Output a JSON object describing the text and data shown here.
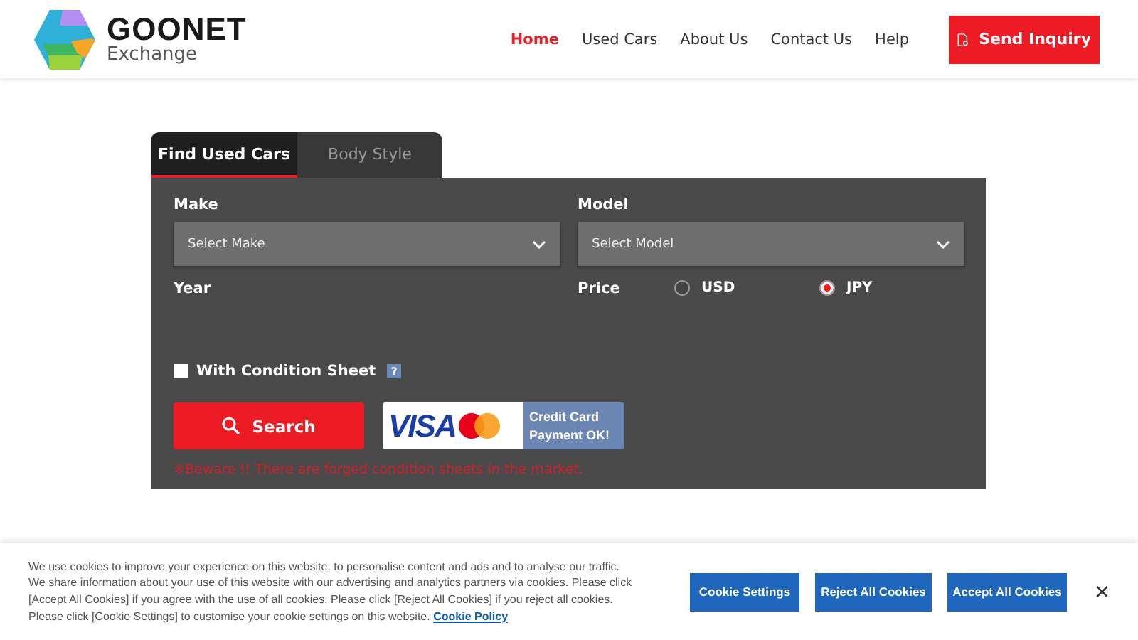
{
  "header": {
    "logo": {
      "name": "GOONET",
      "sub": "Exchange"
    },
    "nav": [
      {
        "label": "Home",
        "selected": true
      },
      {
        "label": "Used Cars",
        "selected": false
      },
      {
        "label": "About Us",
        "selected": false
      },
      {
        "label": "Contact Us",
        "selected": false
      },
      {
        "label": "Help",
        "selected": false
      }
    ],
    "cta": "Send Inquiry"
  },
  "search": {
    "tabs": [
      {
        "label": "Find Used Cars",
        "selected": true
      },
      {
        "label": "Body Style",
        "selected": false
      }
    ],
    "make": {
      "label": "Make",
      "placeholder": "Select Make"
    },
    "model": {
      "label": "Model",
      "placeholder": "Select Model"
    },
    "year": {
      "label": "Year"
    },
    "price": {
      "label": "Price",
      "options": [
        {
          "label": "USD",
          "selected": false
        },
        {
          "label": "JPY",
          "selected": true
        }
      ]
    },
    "condition_sheet": {
      "label": "With Condition Sheet",
      "checked": false,
      "help": "?"
    },
    "button": "Search",
    "payment": {
      "brand": "VISA",
      "text": [
        "Credit Card",
        "Payment OK!"
      ]
    },
    "warning": "※Beware !! There are forged condition sheets in the market."
  },
  "cookie_banner": {
    "text": "We use cookies to improve your experience on this website, to personalise content and ads and to analyse our traffic. We share information about your use of this website with our advertising and analytics partners via cookies. Please click [Accept All Cookies] if you agree with the use of all cookies. Please click [Reject All Cookies] if you reject all cookies. Please click [Cookie Settings] to customise your cookie settings on this website.",
    "link": "Cookie Policy",
    "buttons": [
      "Cookie Settings",
      "Reject All Cookies",
      "Accept All Cookies"
    ],
    "close": "×"
  }
}
